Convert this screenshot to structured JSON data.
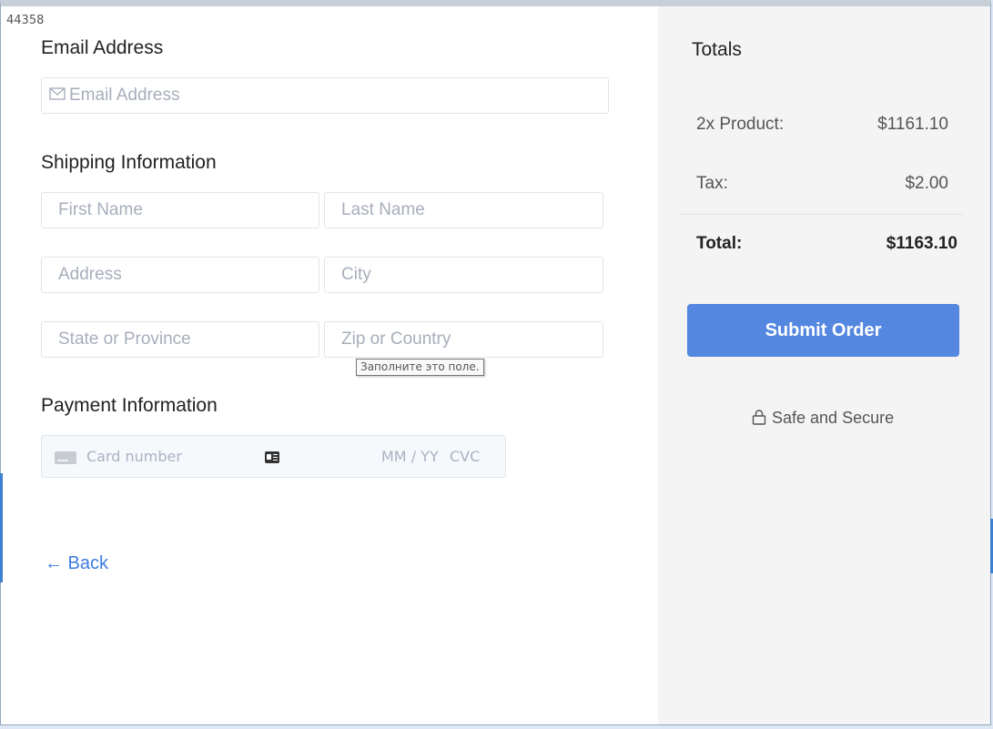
{
  "corner_id": "44358",
  "email": {
    "heading": "Email Address",
    "placeholder": "Email Address",
    "icon": "mail-icon"
  },
  "shipping": {
    "heading": "Shipping Information",
    "first_name": "First Name",
    "last_name": "Last Name",
    "address": "Address",
    "city": "City",
    "state": "State or Province",
    "zip": "Zip or Country"
  },
  "tooltip": "Заполните это поле.",
  "payment": {
    "heading": "Payment Information",
    "card_number": "Card number",
    "expiry": "MM / YY",
    "cvc": "CVC"
  },
  "back_label": "← Back",
  "totals": {
    "title": "Totals",
    "product_label": "2x Product:",
    "product_value": "$1161.10",
    "tax_label": "Tax:",
    "tax_value": "$2.00",
    "total_label": "Total:",
    "total_value": "$1163.10",
    "submit_label": "Submit Order",
    "secure_label": "Safe and Secure"
  },
  "colors": {
    "accent": "#5487e0",
    "link": "#3d7ce0",
    "panel": "#f4f4f4"
  }
}
